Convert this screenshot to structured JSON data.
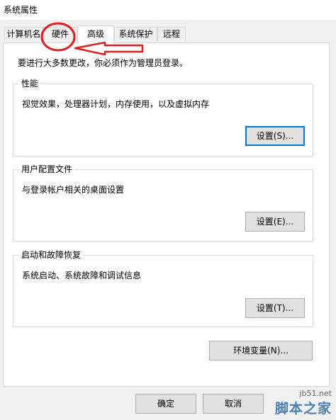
{
  "window": {
    "title": "系统属性"
  },
  "tabs": [
    {
      "label": "计算机名"
    },
    {
      "label": "硬件"
    },
    {
      "label": "高级",
      "active": true
    },
    {
      "label": "系统保护"
    },
    {
      "label": "远程"
    }
  ],
  "intro_text": "要进行大多数更改，你必须作为管理员登录。",
  "groups": {
    "performance": {
      "label": "性能",
      "description": "视觉效果，处理器计划，内存使用，以及虚拟内存",
      "button": "设置(S)..."
    },
    "user_profiles": {
      "label": "用户配置文件",
      "description": "与登录帐户相关的桌面设置",
      "button": "设置(E)..."
    },
    "startup_recovery": {
      "label": "启动和故障恢复",
      "description": "系统启动、系统故障和调试信息",
      "button": "设置(T)..."
    }
  },
  "env_button": "环境变量(N)...",
  "footer": {
    "ok_button": "确定",
    "cancel_button": "取消"
  },
  "annotation": {
    "color": "#e02020",
    "target": "硬件",
    "shapes": [
      "circle",
      "arrow"
    ]
  },
  "watermark": {
    "url": "jb51.net",
    "name": "脚本之家"
  }
}
